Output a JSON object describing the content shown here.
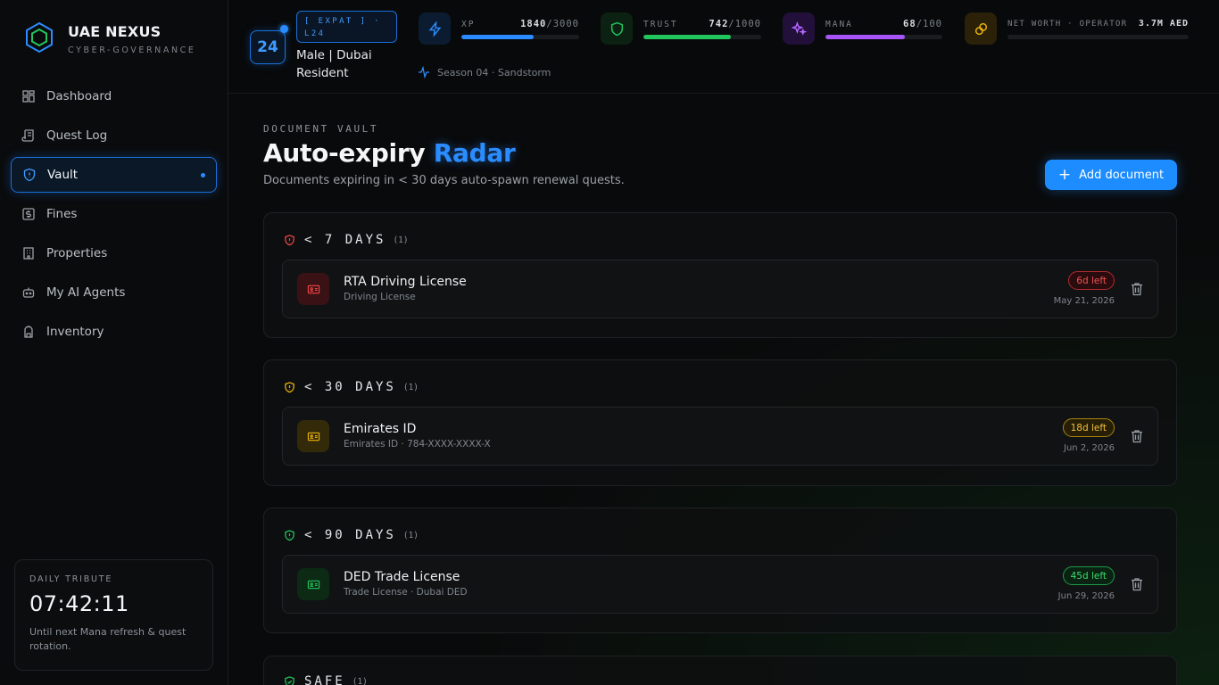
{
  "brand": {
    "title": "UAE NEXUS",
    "subtitle": "CYBER-GOVERNANCE"
  },
  "nav": [
    {
      "label": "Dashboard",
      "icon": "dashboard-icon",
      "active": false
    },
    {
      "label": "Quest Log",
      "icon": "scroll-icon",
      "active": false
    },
    {
      "label": "Vault",
      "icon": "shield-icon",
      "active": true
    },
    {
      "label": "Fines",
      "icon": "dollar-icon",
      "active": false
    },
    {
      "label": "Properties",
      "icon": "building-icon",
      "active": false
    },
    {
      "label": "My AI Agents",
      "icon": "bot-icon",
      "active": false
    },
    {
      "label": "Inventory",
      "icon": "backpack-icon",
      "active": false
    }
  ],
  "tribute": {
    "label": "DAILY TRIBUTE",
    "time": "07:42:11",
    "note": "Until next Mana refresh & quest rotation."
  },
  "profile": {
    "level": "24",
    "tag": "[ EXPAT ] · L24",
    "description": "Male | Dubai Resident",
    "season": "Season 04 · Sandstorm"
  },
  "stats": {
    "xp": {
      "label": "XP",
      "current": "1840",
      "max": "/3000",
      "progress": 0.613,
      "color": "#2a8cff",
      "icon": "bolt-icon"
    },
    "trust": {
      "label": "TRUST",
      "current": "742",
      "max": "/1000",
      "progress": 0.742,
      "color": "#22c55e",
      "icon": "shield-icon"
    },
    "mana": {
      "label": "MANA",
      "current": "68",
      "max": "/100",
      "progress": 0.68,
      "color": "#a855f7",
      "icon": "sparkle-icon"
    },
    "networth": {
      "label": "NET WORTH · OPERATOR",
      "value": "3.7M AED",
      "progress": 0.0,
      "color": "#eab308",
      "icon": "coins-icon"
    }
  },
  "page": {
    "eyebrow": "DOCUMENT VAULT",
    "title_main": "Auto-expiry",
    "title_accent": "Radar",
    "subtitle": "Documents expiring in < 30 days auto-spawn renewal quests.",
    "add_label": "Add document"
  },
  "sections": [
    {
      "title": "< 7 DAYS",
      "count": "(1)",
      "color": "#ef4444",
      "doc": {
        "name": "RTA Driving License",
        "meta": "Driving License",
        "days": "6d left",
        "date": "May 21, 2026"
      }
    },
    {
      "title": "< 30 DAYS",
      "count": "(1)",
      "color": "#eab308",
      "doc": {
        "name": "Emirates ID",
        "meta": "Emirates ID · 784-XXXX-XXXX-X",
        "days": "18d left",
        "date": "Jun 2, 2026"
      }
    },
    {
      "title": "< 90 DAYS",
      "count": "(1)",
      "color": "#22c55e",
      "doc": {
        "name": "DED Trade License",
        "meta": "Trade License · Dubai DED",
        "days": "45d left",
        "date": "Jun 29, 2026"
      }
    },
    {
      "title": "SAFE",
      "count": "(1)",
      "color": "#22c55e"
    }
  ]
}
